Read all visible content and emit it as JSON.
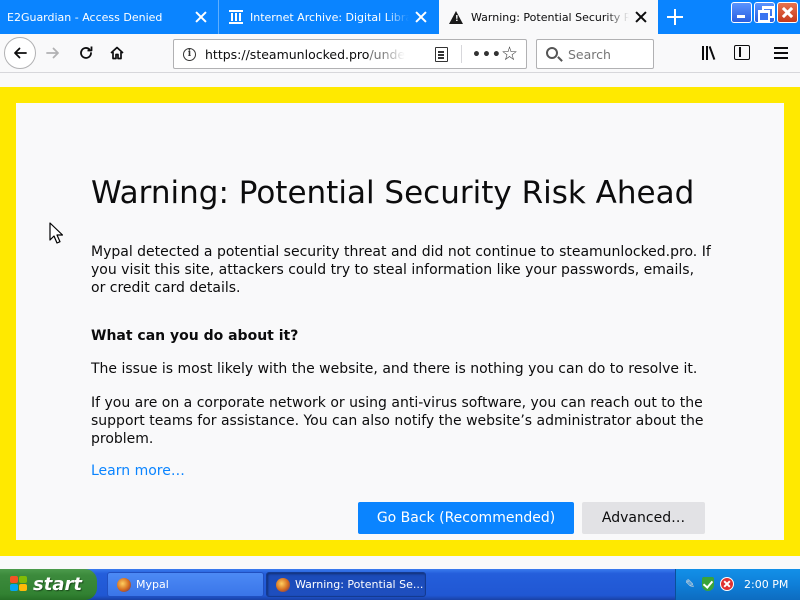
{
  "tabs": [
    {
      "title": "E2Guardian - Access Denied"
    },
    {
      "title": "Internet Archive: Digital Library of Free & Borrowable Books"
    },
    {
      "title": "Warning: Potential Security Risk Ahead"
    }
  ],
  "navbar": {
    "url_main": "https://steamunlocked.pro",
    "url_rest": "/undertale-free-download/",
    "search_placeholder": "Search",
    "info_glyph": "i",
    "more_glyph": "•••",
    "star_glyph": "☆"
  },
  "error_page": {
    "title": "Warning: Potential Security Risk Ahead",
    "intro": "Mypal detected a potential security threat and did not continue to steamunlocked.pro. If you visit this site, attackers could try to steal information like your passwords, emails, or credit card details.",
    "what_heading": "What can you do about it?",
    "issue_text": "The issue is most likely with the website, and there is nothing you can do to resolve it.",
    "corporate_text": "If you are on a corporate network or using anti-virus software, you can reach out to the support teams for assistance. You can also notify the website’s administrator about the problem.",
    "learn_more": "Learn more…",
    "go_back_label": "Go Back (Recommended)",
    "advanced_label": "Advanced…"
  },
  "taskbar": {
    "start_label": "start",
    "items": [
      {
        "label": "Mypal"
      },
      {
        "label": "Warning: Potential Se..."
      }
    ],
    "clock": "2:00 PM"
  },
  "colors": {
    "accent": "#0a84ff",
    "warning_frame": "#ffe900",
    "tab_strip": "#0a84ff",
    "page_background": "#f9f9fa"
  },
  "icons": [
    "close-icon",
    "archive-temple-icon",
    "warning-icon",
    "new-tab-icon",
    "back-arrow-icon",
    "forward-arrow-icon",
    "reload-icon",
    "home-icon",
    "info-icon",
    "reader-view-icon",
    "more-icon",
    "star-icon",
    "search-icon",
    "library-icon",
    "sidebar-icon",
    "menu-icon",
    "windows-logo-icon",
    "mypal-icon",
    "tools-icon",
    "security-shield-icon",
    "blocked-icon"
  ]
}
